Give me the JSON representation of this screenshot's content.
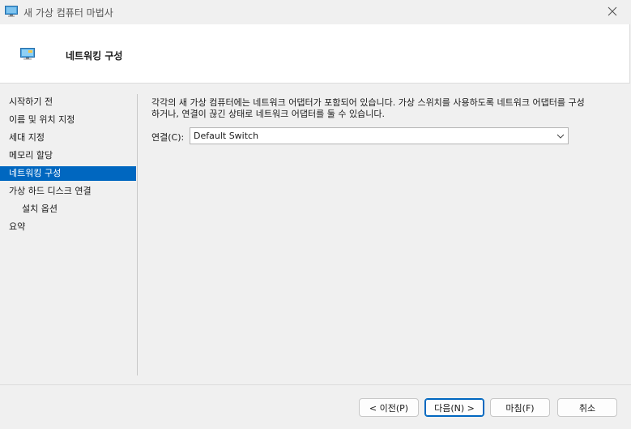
{
  "window": {
    "title": "새 가상 컴퓨터 마법사",
    "close_icon": "close-icon",
    "app_icon": "monitor-icon"
  },
  "header": {
    "title": "네트워킹 구성",
    "icon": "monitor-icon"
  },
  "sidebar": {
    "items": [
      {
        "label": "시작하기 전",
        "active": false,
        "sub": false
      },
      {
        "label": "이름 및 위치 지정",
        "active": false,
        "sub": false
      },
      {
        "label": "세대 지정",
        "active": false,
        "sub": false
      },
      {
        "label": "메모리 할당",
        "active": false,
        "sub": false
      },
      {
        "label": "네트워킹 구성",
        "active": true,
        "sub": false
      },
      {
        "label": "가상 하드 디스크 연결",
        "active": false,
        "sub": false
      },
      {
        "label": "설치 옵션",
        "active": false,
        "sub": true
      },
      {
        "label": "요약",
        "active": false,
        "sub": false
      }
    ]
  },
  "main": {
    "description_line1": "각각의 새 가상 컴퓨터에는 네트워크 어댑터가 포함되어 있습니다. 가상 스위치를 사용하도록 네트워크 어댑터를 구성",
    "description_line2": "하거나, 연결이 끊긴 상태로 네트워크 어댑터를 둘 수 있습니다.",
    "connection_label": "연결(C):",
    "connection_value": "Default Switch"
  },
  "buttons": {
    "prev": "< 이전(P)",
    "next": "다음(N) >",
    "finish": "마침(F)",
    "cancel": "취소"
  },
  "colors": {
    "accent": "#0067c0",
    "background": "#f0f0f0",
    "header_bg": "#ffffff"
  }
}
